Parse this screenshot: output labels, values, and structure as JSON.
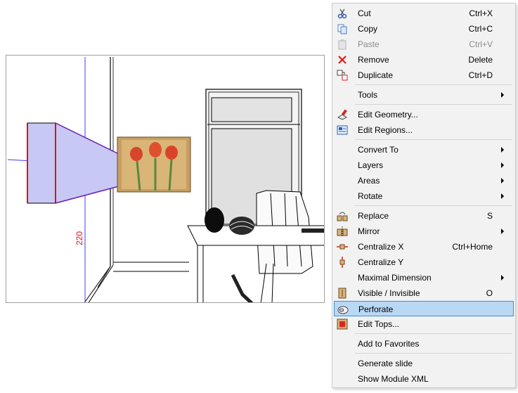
{
  "menu": {
    "items": [
      {
        "key": "cut",
        "label": "Cut",
        "shortcut": "Ctrl+X",
        "icon": "scissors-icon"
      },
      {
        "key": "copy",
        "label": "Copy",
        "shortcut": "Ctrl+C",
        "icon": "copy-icon"
      },
      {
        "key": "paste",
        "label": "Paste",
        "shortcut": "Ctrl+V",
        "icon": "paste-icon",
        "disabled": true
      },
      {
        "key": "remove",
        "label": "Remove",
        "shortcut": "Delete",
        "icon": "red-x-icon"
      },
      {
        "key": "duplicate",
        "label": "Duplicate",
        "shortcut": "Ctrl+D",
        "icon": "duplicate-icon"
      },
      {
        "key": "tools",
        "label": "Tools",
        "submenu": true
      },
      {
        "key": "edit-geometry",
        "label": "Edit Geometry...",
        "icon": "edit-geometry-icon"
      },
      {
        "key": "edit-regions",
        "label": "Edit Regions...",
        "icon": "edit-regions-icon"
      },
      {
        "key": "convert-to",
        "label": "Convert To",
        "submenu": true
      },
      {
        "key": "layers",
        "label": "Layers",
        "submenu": true
      },
      {
        "key": "areas",
        "label": "Areas",
        "submenu": true
      },
      {
        "key": "rotate",
        "label": "Rotate",
        "submenu": true
      },
      {
        "key": "replace",
        "label": "Replace",
        "shortcut": "S",
        "icon": "replace-icon"
      },
      {
        "key": "mirror",
        "label": "Mirror",
        "submenu": true,
        "icon": "mirror-icon"
      },
      {
        "key": "centralize-x",
        "label": "Centralize X",
        "shortcut": "Ctrl+Home",
        "icon": "centralize-x-icon"
      },
      {
        "key": "centralize-y",
        "label": "Centralize Y",
        "icon": "centralize-y-icon"
      },
      {
        "key": "maximal-dimension",
        "label": "Maximal Dimension",
        "submenu": true
      },
      {
        "key": "visible-invisible",
        "label": "Visible / Invisible",
        "shortcut": "O",
        "icon": "visibility-icon"
      },
      {
        "key": "perforate",
        "label": "Perforate",
        "icon": "perforate-icon",
        "highlighted": true
      },
      {
        "key": "edit-tops",
        "label": "Edit Tops...",
        "icon": "edit-tops-icon"
      },
      {
        "key": "add-to-favorites",
        "label": "Add to Favorites"
      },
      {
        "key": "generate-slide",
        "label": "Generate slide"
      },
      {
        "key": "show-module-xml",
        "label": "Show Module XML"
      }
    ]
  },
  "viewport": {
    "dimension_label": "220",
    "selection_color": "#c8c8f4",
    "accent_blue": "#3c3cff",
    "accent_red": "#e01010"
  }
}
